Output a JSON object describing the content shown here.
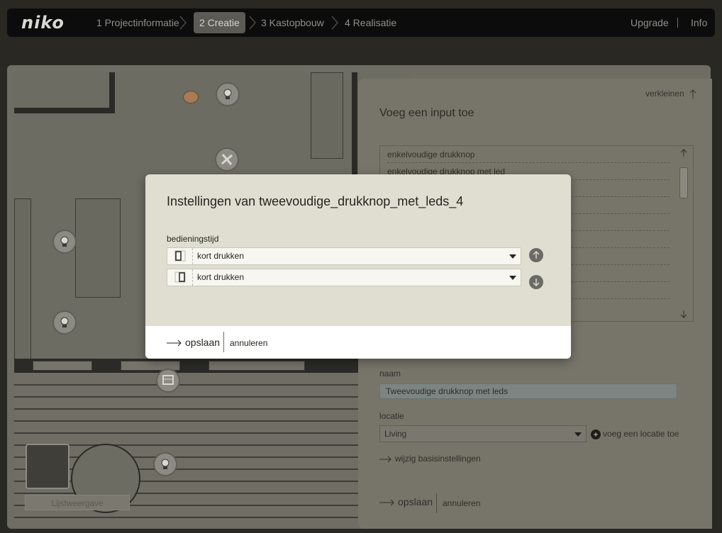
{
  "app": {
    "logo": "niko"
  },
  "steps": [
    {
      "label": "1 Projectinformatie",
      "active": false
    },
    {
      "label": "2 Creatie",
      "active": true
    },
    {
      "label": "3 Kastopbouw",
      "active": false
    },
    {
      "label": "4 Realisatie",
      "active": false
    }
  ],
  "top_right": {
    "upgrade": "Upgrade",
    "info": "Info"
  },
  "floorplan": {
    "list_view_label": "Lijstweergave"
  },
  "right_panel": {
    "shrink_label": "verkleinen",
    "title": "Voeg een input toe",
    "list_items": [
      "enkelvoudige drukknop",
      "enkelvoudige drukknop met led",
      "",
      "",
      "",
      "",
      "",
      "",
      "",
      ""
    ],
    "name_label": "naam",
    "name_value": "Tweevoudige drukknop met leds",
    "location_label": "locatie",
    "location_value": "Living",
    "add_location": "voeg een locatie toe",
    "change_settings": "wijzig basisinstellingen",
    "save": "opslaan",
    "cancel": "annuleren"
  },
  "modal": {
    "title": "Instellingen van tweevoudige_drukknop_met_leds_4",
    "field_label": "bedieningstijd",
    "rows": [
      {
        "value": "kort drukken"
      },
      {
        "value": "kort drukken"
      }
    ],
    "save": "opslaan",
    "cancel": "annuleren"
  }
}
